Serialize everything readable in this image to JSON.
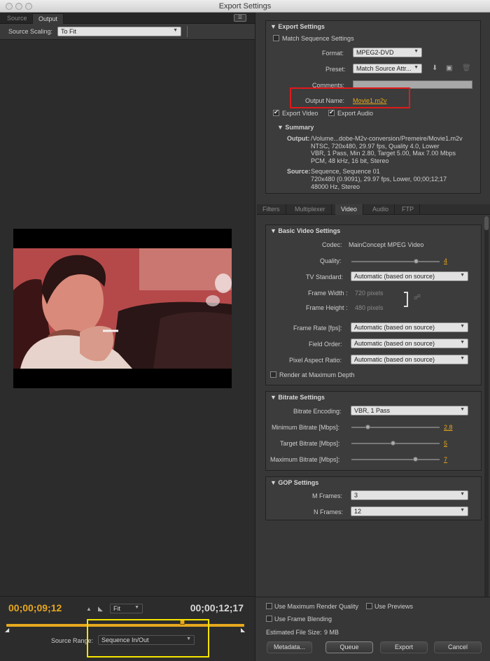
{
  "window": {
    "title": "Export Settings"
  },
  "left": {
    "tabs": [
      {
        "label": "Source"
      },
      {
        "label": "Output"
      }
    ],
    "source_scaling": {
      "label": "Source Scaling:",
      "value": "To Fit"
    },
    "timecode_current": "00;00;09;12",
    "timecode_duration": "00;00;12;17",
    "zoom": "Fit",
    "source_range": {
      "label": "Source Range:",
      "value": "Sequence In/Out"
    }
  },
  "export_settings": {
    "header": "Export Settings",
    "match_sequence": "Match Sequence Settings",
    "format_label": "Format:",
    "format_value": "MPEG2-DVD",
    "preset_label": "Preset:",
    "preset_value": "Match Source Attr...",
    "comments_label": "Comments:",
    "output_name_label": "Output Name:",
    "output_name_value": "Movie1.m2v",
    "export_video": "Export Video",
    "export_audio": "Export Audio",
    "summary": {
      "header": "Summary",
      "output_label": "Output:",
      "output_lines": [
        "/Volume...dobe-M2v-conversion/Premeire/Movie1.m2v",
        "NTSC, 720x480, 29.97 fps, Quality 4.0, Lower",
        "VBR, 1 Pass, Min 2.80, Target 5.00, Max 7.00 Mbps",
        "PCM, 48 kHz, 16 bit, Stereo"
      ],
      "source_label": "Source:",
      "source_lines": [
        "Sequence, Sequence 01",
        "720x480 (0.9091), 29.97 fps, Lower, 00;00;12;17",
        "48000 Hz, Stereo"
      ]
    }
  },
  "sub_tabs": [
    "Filters",
    "Multiplexer",
    "Video",
    "Audio",
    "FTP"
  ],
  "basic_video": {
    "header": "Basic Video Settings",
    "codec_label": "Codec:",
    "codec_value": "MainConcept MPEG Video",
    "quality_label": "Quality:",
    "quality_value": "4",
    "quality_level": 0.75,
    "tv_standard_label": "TV Standard:",
    "tv_standard_value": "Automatic (based on source)",
    "frame_width_label": "Frame Width :",
    "frame_width_value": "720 pixels",
    "frame_height_label": "Frame Height :",
    "frame_height_value": "480 pixels",
    "frame_rate_label": "Frame Rate [fps]:",
    "frame_rate_value": "Automatic (based on source)",
    "field_order_label": "Field Order:",
    "field_order_value": "Automatic (based on source)",
    "par_label": "Pixel Aspect Ratio:",
    "par_value": "Automatic (based on source)",
    "render_max_depth": "Render at Maximum Depth"
  },
  "bitrate": {
    "header": "Bitrate Settings",
    "encoding_label": "Bitrate Encoding:",
    "encoding_value": "VBR, 1 Pass",
    "min_label": "Minimum Bitrate [Mbps]:",
    "min_value": "2.8",
    "min_level": 0.17,
    "target_label": "Target Bitrate [Mbps]:",
    "target_value": "5",
    "target_level": 0.47,
    "max_label": "Maximum Bitrate [Mbps]:",
    "max_value": "7",
    "max_level": 0.74
  },
  "gop": {
    "header": "GOP Settings",
    "m_label": "M Frames:",
    "m_value": "3",
    "n_label": "N Frames:",
    "n_value": "12"
  },
  "bottom": {
    "max_render_quality": "Use Maximum Render Quality",
    "use_previews": "Use Previews",
    "frame_blending": "Use Frame Blending",
    "estimated_size_label": "Estimated File Size:",
    "estimated_size_value": "9 MB",
    "metadata_button": "Metadata...",
    "queue_button": "Queue",
    "export_button": "Export",
    "cancel_button": "Cancel"
  }
}
